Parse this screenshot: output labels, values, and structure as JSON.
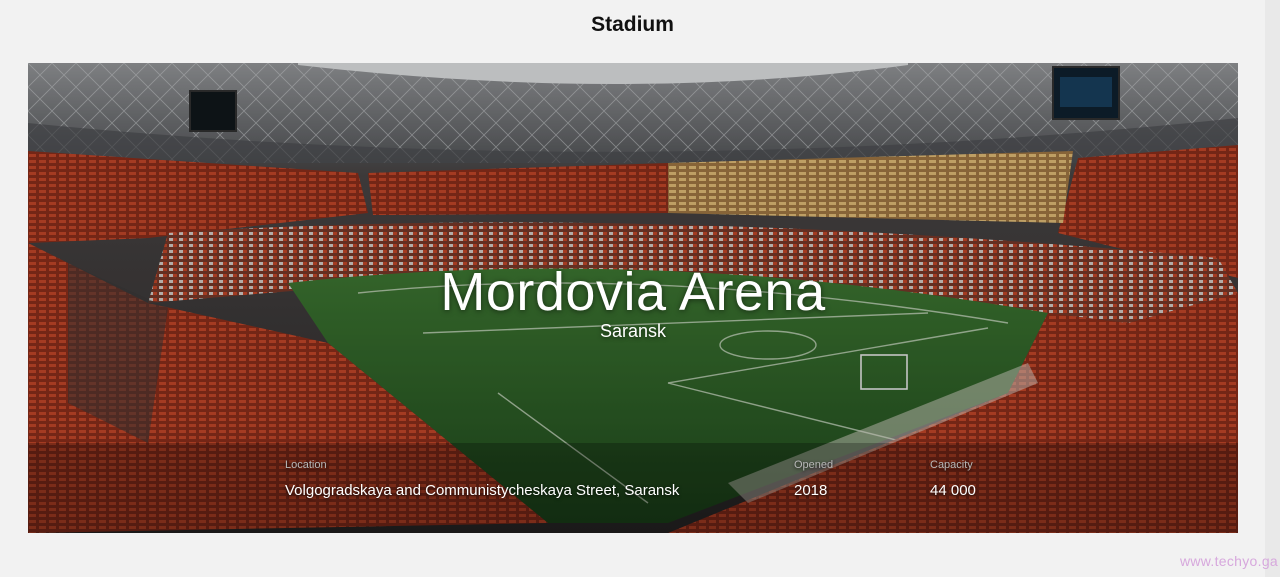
{
  "page": {
    "title": "Stadium"
  },
  "stadium": {
    "name": "Mordovia Arena",
    "city": "Saransk",
    "details": [
      {
        "label": "Location",
        "value": "Volgogradskaya and Communistycheskaya Street, Saransk"
      },
      {
        "label": "Opened",
        "value": "2018"
      },
      {
        "label": "Capacity",
        "value": "44 000"
      }
    ]
  },
  "watermark": "www.techyo.ga",
  "colors": {
    "page_background": "#f2f2f2",
    "seats": "#c44a2a",
    "pitch": "#2f6a2a",
    "upper_seats": "#d9a85e"
  }
}
